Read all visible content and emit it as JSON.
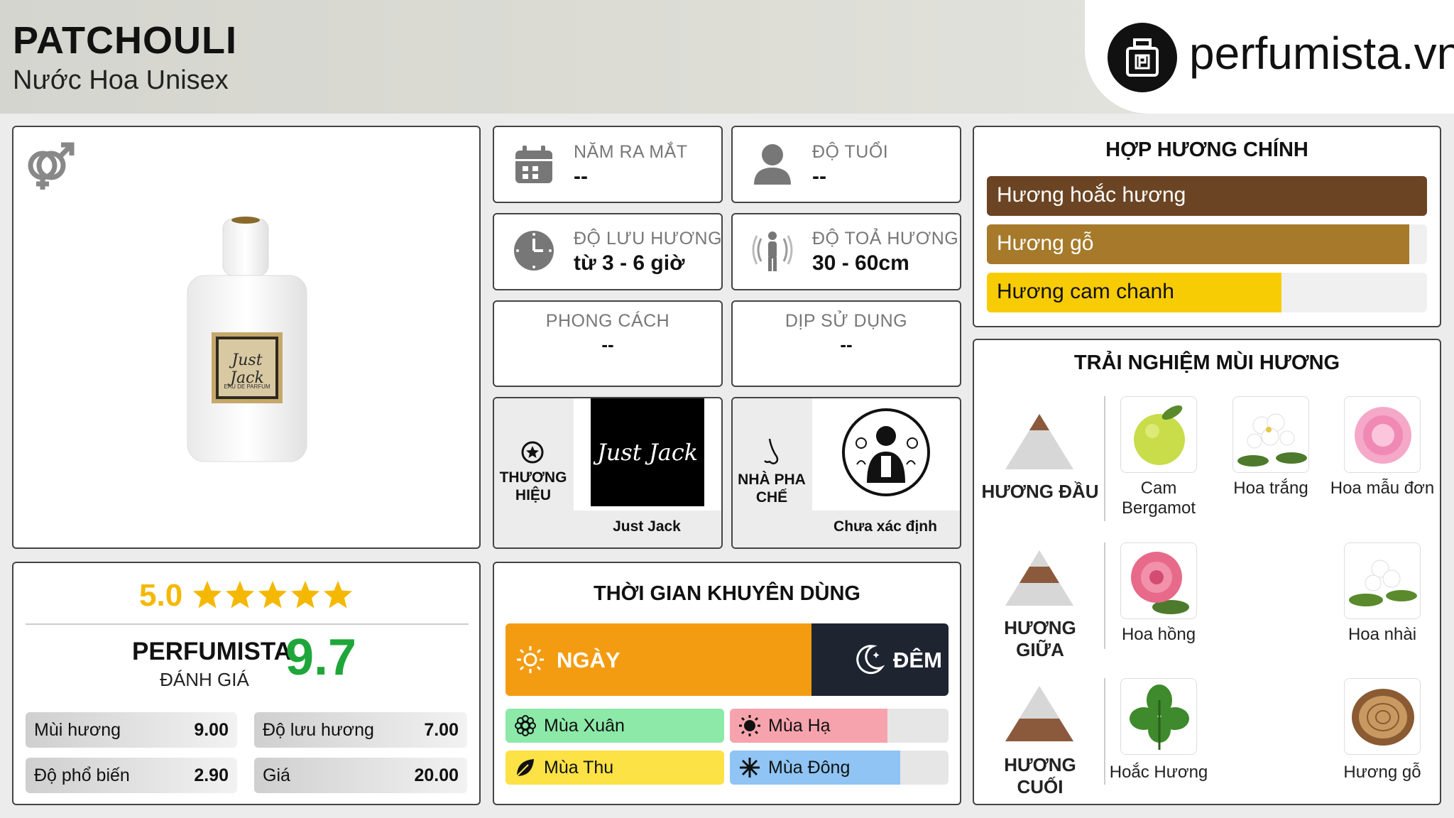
{
  "header": {
    "title": "PATCHOULI",
    "subtitle": "Nước Hoa Unisex",
    "logo_text": "perfumista.vn"
  },
  "product": {
    "bottle_label_script": "Just Jack",
    "bottle_label_sub": "EAU DE PARFUM",
    "gender_icon": "unisex-gender-icon"
  },
  "info": {
    "release": {
      "label": "NĂM RA MẮT",
      "value": "--"
    },
    "age": {
      "label": "ĐỘ TUỔI",
      "value": "--"
    },
    "longevity": {
      "label": "ĐỘ LƯU HƯƠNG",
      "value": "từ 3 - 6 giờ"
    },
    "sillage": {
      "label": "ĐỘ TOẢ HƯƠNG",
      "value": "30 - 60cm"
    },
    "style": {
      "label": "PHONG CÁCH",
      "value": "--"
    },
    "occasion": {
      "label": "DỊP SỬ DỤNG",
      "value": "--"
    },
    "brand": {
      "label": "THƯƠNG HIỆU",
      "name": "Just Jack",
      "logo_script": "Just Jack"
    },
    "perfumer": {
      "label": "NHÀ PHA CHẾ",
      "name": "Chưa xác định"
    }
  },
  "accords": {
    "title": "HỢP HƯƠNG CHÍNH",
    "items": [
      {
        "label": "Hương hoắc hương",
        "fraction": 1.0,
        "color": "#6b4423",
        "text_color": "#ffffff"
      },
      {
        "label": "Hương gỗ",
        "fraction": 0.96,
        "color": "#a67a2a",
        "text_color": "#ffffff"
      },
      {
        "label": "Hương cam chanh",
        "fraction": 0.67,
        "color": "#f8cc05",
        "text_color": "#111111"
      }
    ]
  },
  "rating": {
    "score": "5.0",
    "stars": 5,
    "perfumista_label": "PERFUMISTA",
    "perfumista_sub": "ĐÁNH GIÁ",
    "perfumista_score": "9.7",
    "scores": [
      {
        "label": "Mùi hương",
        "value": "9.00"
      },
      {
        "label": "Độ lưu hương",
        "value": "7.00"
      },
      {
        "label": "Độ phổ biến",
        "value": "2.90"
      },
      {
        "label": "Giá",
        "value": "20.00"
      }
    ]
  },
  "time": {
    "title": "THỜI GIAN KHUYÊN DÙNG",
    "day_label": "NGÀY",
    "night_label": "ĐÊM",
    "day_fraction": 0.69,
    "day_color": "#f39c12",
    "night_color": "#1e2430",
    "seasons": [
      {
        "label": "Mùa Xuân",
        "fraction": 1.0,
        "color": "#8ce9a8",
        "icon": "flower-icon"
      },
      {
        "label": "Mùa Hạ",
        "fraction": 0.72,
        "color": "#f7a3ad",
        "icon": "sun-icon"
      },
      {
        "label": "Mùa Thu",
        "fraction": 1.0,
        "color": "#fce244",
        "icon": "leaf-icon"
      },
      {
        "label": "Mùa Đông",
        "fraction": 0.78,
        "color": "#8fc4f5",
        "icon": "snowflake-icon"
      }
    ]
  },
  "notes": {
    "title": "TRẢI NGHIỆM MÙI HƯƠNG",
    "top": {
      "label": "HƯƠNG ĐẦU",
      "items": [
        "Cam Bergamot",
        "Hoa trắng",
        "Hoa mẫu đơn"
      ]
    },
    "middle": {
      "label": "HƯƠNG GIỮA",
      "items": [
        "Hoa hồng",
        "Hoa nhài"
      ]
    },
    "base": {
      "label": "HƯƠNG CUỐI",
      "items": [
        "Hoắc Hương",
        "Hương gỗ"
      ]
    }
  }
}
